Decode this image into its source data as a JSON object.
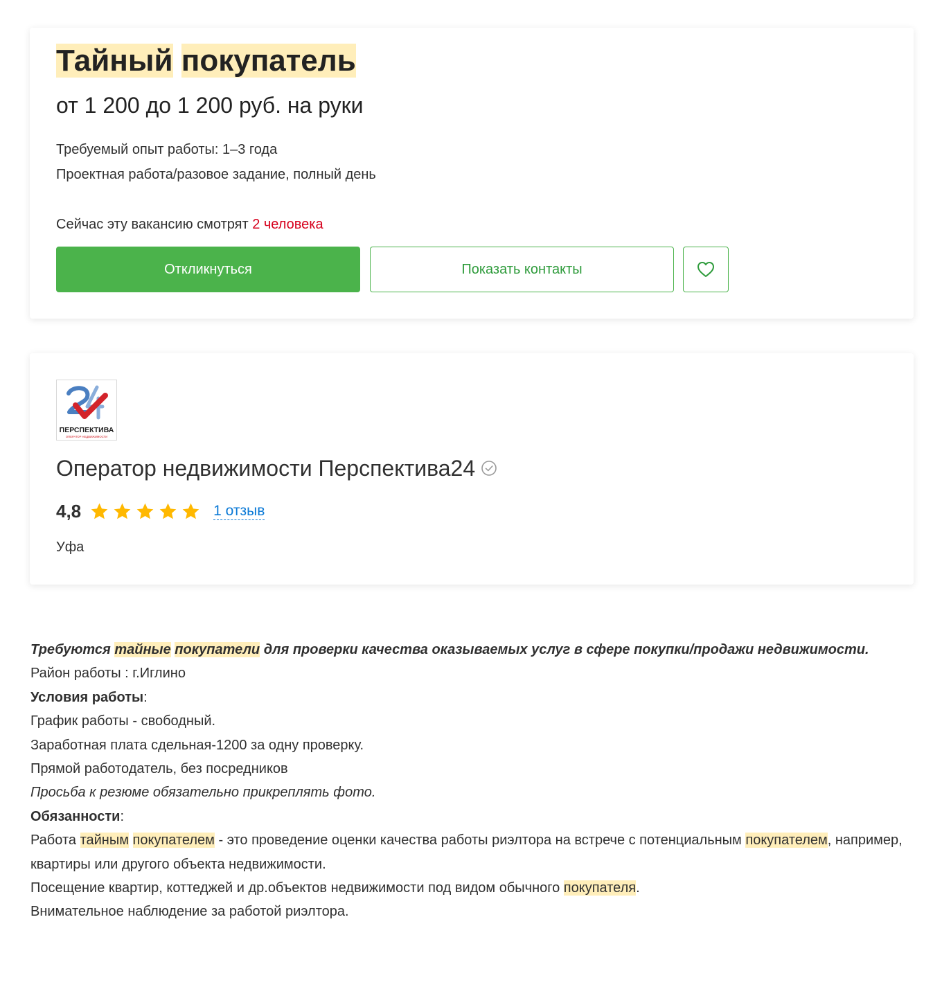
{
  "vacancy": {
    "title_word1": "Тайный",
    "title_word2": "покупатель",
    "salary": "от 1 200 до 1 200 руб. на руки",
    "experience": "Требуемый опыт работы: 1–3 года",
    "employment": "Проектная работа/разовое задание, полный день",
    "viewers_prefix": "Сейчас эту вакансию смотрят",
    "viewers_count": "2 человека",
    "apply_label": "Откликнуться",
    "contacts_label": "Показать контакты",
    "favorite_icon": "heart-icon"
  },
  "company": {
    "logo_text": "ПЕРСПЕКТИВА",
    "logo_subtext": "ОПЕРАТОР НЕДВИЖИМОСТИ",
    "logo_number": "24",
    "name": "Оператор недвижимости Перспектива24",
    "verified_icon": "verified-check-icon",
    "rating": "4,8",
    "rating_value": 4.8,
    "rating_max": 5,
    "reviews_link": "1 отзыв",
    "city": "Уфа"
  },
  "description": {
    "lead_1": "Требуются",
    "lead_hl1": "тайные",
    "lead_hl2": "покупатели",
    "lead_2": "для проверки качества оказываемых услуг в сфере покупки/продажи недвижимости.",
    "area": "Район работы : г.Иглино",
    "conditions_title": "Условия работы",
    "conditions_colon": ":",
    "schedule": "График работы - свободный.",
    "pay": "Заработная плата сдельная-1200 за одну проверку.",
    "direct": "Прямой работодатель, без посредников",
    "photo_note": "Просьба к резюме обязательно прикреплять фото.",
    "duties_title": "Обязанности",
    "duties_colon": ":",
    "duty1_a": "Работа",
    "duty1_hl1": "тайным",
    "duty1_hl2": "покупателем",
    "duty1_b": "- это проведение оценки качества работы риэлтора на встрече с потенциальным",
    "duty1_hl3": "покупателем",
    "duty1_c": ", например, квартиры или другого объекта недвижимости.",
    "duty2_a": "Посещение квартир, коттеджей и др.объектов недвижимости под видом обычного",
    "duty2_hl": "покупателя",
    "duty2_b": ".",
    "duty3": "Внимательное наблюдение за работой риэлтора."
  },
  "colors": {
    "accent_green": "#4bb34b",
    "highlight": "#ffeeba",
    "viewers_red": "#d6001c",
    "link_blue": "#0a79d6",
    "star": "#ffb800"
  }
}
